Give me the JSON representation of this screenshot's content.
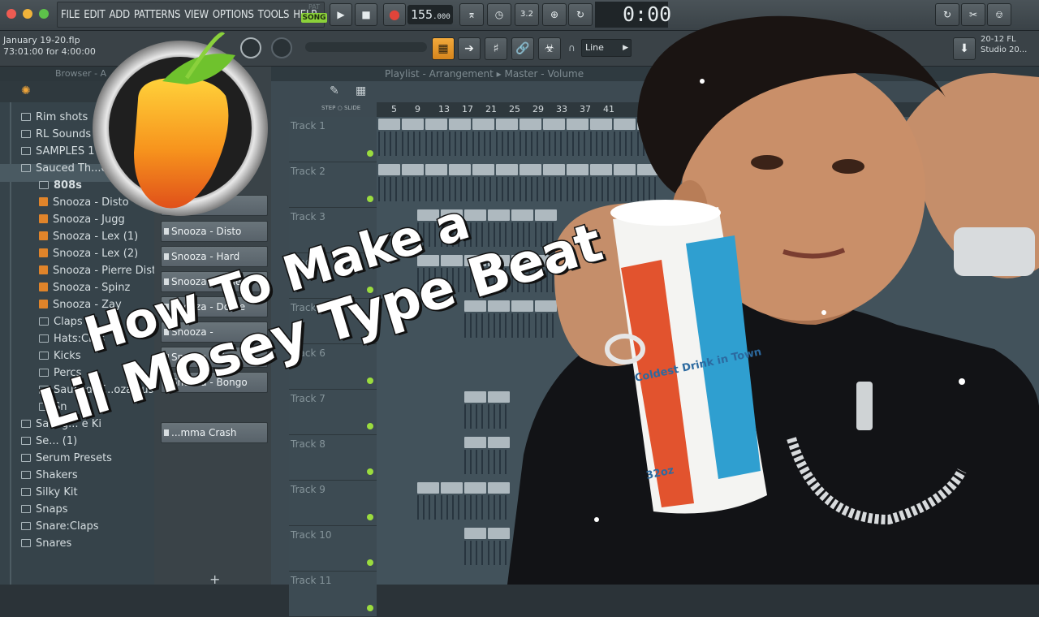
{
  "menu": {
    "items": [
      "FILE",
      "EDIT",
      "ADD",
      "PATTERNS",
      "VIEW",
      "OPTIONS",
      "TOOLS",
      "HELP"
    ]
  },
  "transport": {
    "pat_label": "PAT",
    "song_label": "SONG",
    "tempo": "155",
    "tempo_frac": ".000",
    "time": "0:00"
  },
  "project": {
    "filename": "January 19-20.flp",
    "position": "73:01:00 for 4:00:00"
  },
  "snap": {
    "value": "Line"
  },
  "fl_info": {
    "line1": "20-12 FL",
    "line2": "Studio 20..."
  },
  "browser": {
    "title": "Browser - A",
    "items": [
      {
        "label": "Rim shots",
        "kind": "folder"
      },
      {
        "label": "RL Sounds",
        "kind": "folder"
      },
      {
        "label": "SAMPLES 1",
        "kind": "folder"
      },
      {
        "label": "Sauced Th...oza",
        "kind": "folder-open"
      },
      {
        "label": "808s",
        "kind": "subfolder"
      },
      {
        "label": "Snooza - Disto",
        "kind": "sound"
      },
      {
        "label": "Snooza - Jugg",
        "kind": "sound"
      },
      {
        "label": "Snooza - Lex (1)",
        "kind": "sound"
      },
      {
        "label": "Snooza - Lex (2)",
        "kind": "sound"
      },
      {
        "label": "Snooza - Pierre Disto",
        "kind": "sound"
      },
      {
        "label": "Snooza - Spinz",
        "kind": "sound"
      },
      {
        "label": "Snooza - Zay",
        "kind": "sound"
      },
      {
        "label": "Claps",
        "kind": "subfolder"
      },
      {
        "label": "Hats:Cras",
        "kind": "subfolder"
      },
      {
        "label": "Kicks",
        "kind": "subfolder"
      },
      {
        "label": "Percs",
        "kind": "subfolder"
      },
      {
        "label": "Saucedl T...ozaMusic",
        "kind": "subfolder"
      },
      {
        "label": "Sn",
        "kind": "subfolder"
      },
      {
        "label": "Savag... e Ki",
        "kind": "folder"
      },
      {
        "label": "Se... (1)",
        "kind": "folder"
      },
      {
        "label": "Serum Presets",
        "kind": "folder"
      },
      {
        "label": "Shakers",
        "kind": "folder"
      },
      {
        "label": "Silky Kit",
        "kind": "folder"
      },
      {
        "label": "Snaps",
        "kind": "folder"
      },
      {
        "label": "Snare:Claps",
        "kind": "folder"
      },
      {
        "label": "Snares",
        "kind": "folder"
      }
    ]
  },
  "channel_rack": {
    "channels": [
      "...ic] #2",
      "Snooza - Disto",
      "Snooza - Hard",
      "Snooza - Code",
      "Snooza - Dome",
      "Snooza -",
      "Snooza - Pier",
      "Snooza - Bongo",
      "...mma Crash"
    ]
  },
  "playlist": {
    "header": "Playlist - Arrangement",
    "breadcrumb": "Master - Volume",
    "step_label": "STEP",
    "slide_label": "SLIDE",
    "ruler": [
      "5",
      "9",
      "13",
      "17",
      "21",
      "25",
      "29",
      "33",
      "37",
      "41"
    ],
    "tracks": [
      "Track 1",
      "Track 2",
      "Track 3",
      "Track 4",
      "Track 5",
      "Track 6",
      "Track 7",
      "Track 8",
      "Track 9",
      "Track 10",
      "Track 11"
    ],
    "add_label": "+"
  },
  "thumbnail": {
    "title_line1": "How To Make a",
    "title_line2": "Lil Mosey Type Beat",
    "cup_text": "Coldest Drink in Town",
    "cup_size": "32oz"
  }
}
